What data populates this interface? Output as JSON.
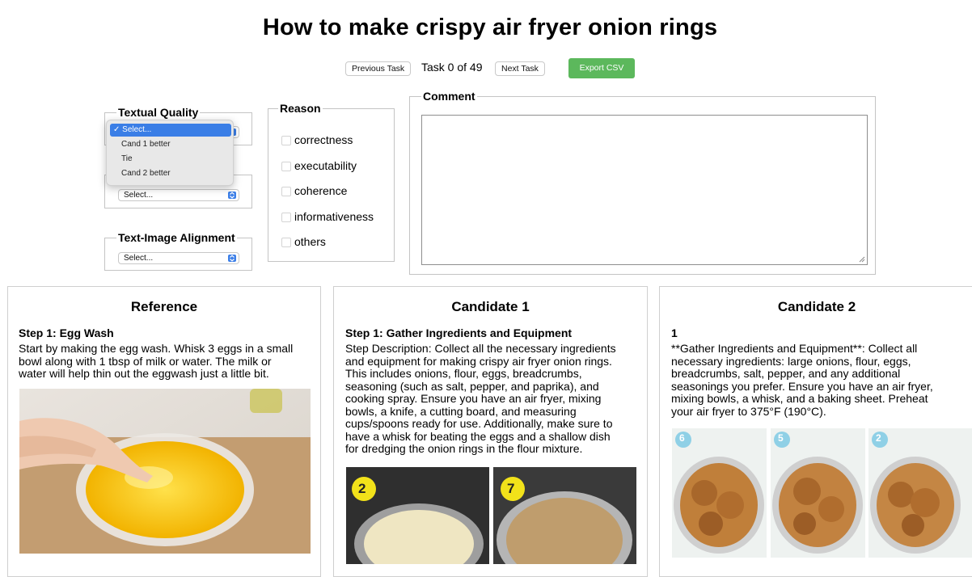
{
  "page_title": "How to make crispy air fryer onion rings",
  "nav": {
    "previous_label": "Previous Task",
    "task_counter": "Task 0 of 49",
    "next_label": "Next Task",
    "export_label": "Export CSV"
  },
  "textual_quality": {
    "legend": "Textual Quality",
    "dropdown_options": [
      "✓ Select...",
      "Cand 1 better",
      "Tie",
      "Cand 2 better"
    ]
  },
  "second_select": {
    "value": "Select..."
  },
  "text_image_alignment": {
    "legend": "Text-Image Alignment",
    "value": "Select..."
  },
  "reason": {
    "legend": "Reason",
    "options": [
      "correctness",
      "executability",
      "coherence",
      "informativeness",
      "others"
    ]
  },
  "comment": {
    "legend": "Comment",
    "value": ""
  },
  "panels": {
    "reference": {
      "heading": "Reference",
      "step_title": "Step 1: Egg Wash",
      "step_lines": [
        "Start by making the egg wash. Whisk 3 eggs in a small",
        "bowl along with 1 tbsp of milk or water. The milk or",
        "water will help thin out the eggwash just a little bit."
      ]
    },
    "candidate1": {
      "heading": "Candidate 1",
      "step_title": "Step 1: Gather Ingredients and Equipment",
      "step_lines": [
        "Step Description: Collect all the necessary ingredients",
        "and equipment for making crispy air fryer onion rings.",
        "This includes onions, flour, eggs, breadcrumbs,",
        "seasoning (such as salt, pepper, and paprika), and",
        "cooking spray. Ensure you have an air fryer, mixing",
        "bowls, a knife, a cutting board, and measuring",
        "cups/spoons ready for use. Additionally, make sure to",
        "have a whisk for beating the eggs and a shallow dish",
        "for dredging the onion rings in the flour mixture."
      ],
      "badges": [
        "2",
        "7"
      ]
    },
    "candidate2": {
      "heading": "Candidate 2",
      "step_title": "1",
      "step_lines": [
        "**Gather Ingredients and Equipment**: Collect all",
        "necessary ingredients: large onions, flour, eggs,",
        "breadcrumbs, salt, pepper, and any additional",
        "seasonings you prefer. Ensure you have an air fryer,",
        "mixing bowls, a whisk, and a baking sheet. Preheat",
        "your air fryer to 375°F (190°C)."
      ],
      "badges": [
        "6",
        "5",
        "2"
      ]
    }
  },
  "colors": {
    "export_button": "#5cb85c",
    "select_highlight": "#3a7ee6",
    "border": "#c4c4c4"
  }
}
